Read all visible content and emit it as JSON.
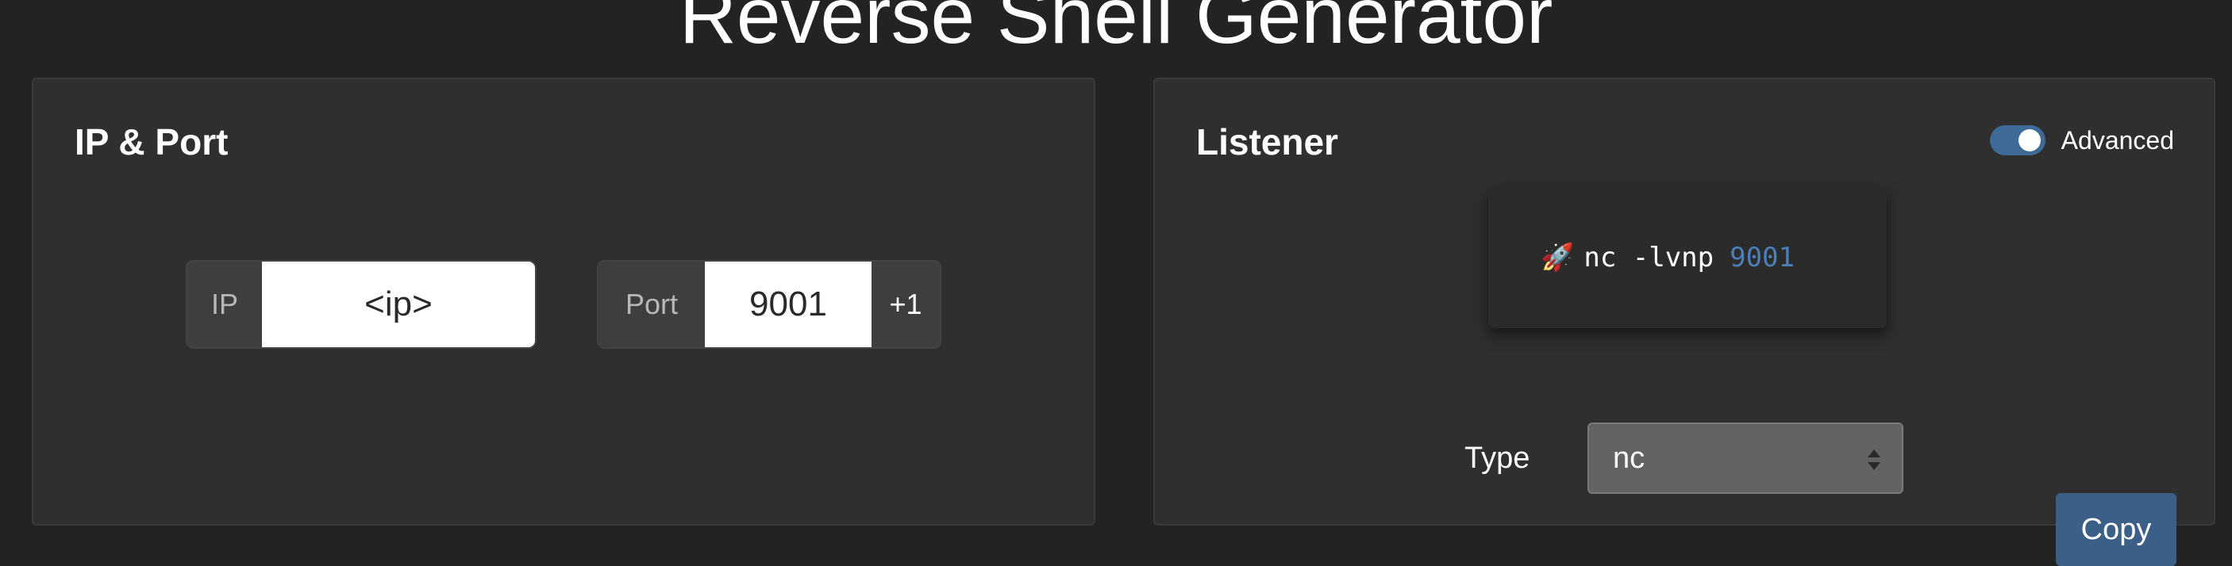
{
  "page": {
    "title": "Reverse Shell Generator"
  },
  "ip_port": {
    "title": "IP & Port",
    "ip_label": "IP",
    "ip_value": "<ip>",
    "port_label": "Port",
    "port_value": "9001",
    "increment_label": "+1"
  },
  "listener": {
    "title": "Listener",
    "advanced_label": "Advanced",
    "advanced_enabled": true,
    "command_icon": "rocket-icon",
    "command_text": "nc -lvnp",
    "command_port": "9001",
    "type_label": "Type",
    "type_value": "nc",
    "copy_label": "Copy"
  },
  "colors": {
    "background": "#232323",
    "card": "#2f2f2f",
    "accent": "#3b5f87",
    "port_highlight": "#4a7fb8"
  }
}
